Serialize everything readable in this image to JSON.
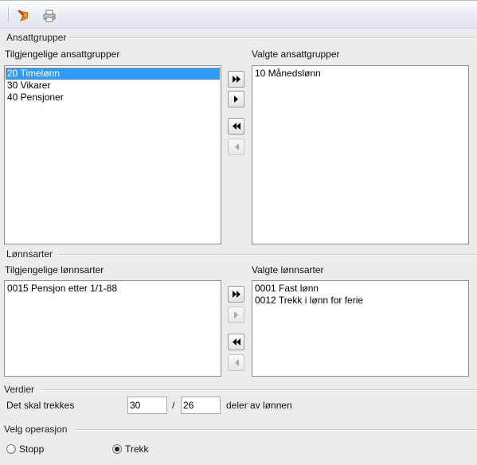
{
  "toolbar": {
    "icons": [
      "clear-icon",
      "print-icon"
    ]
  },
  "ansattgrupper": {
    "section_title": "Ansattgrupper",
    "available_label": "Tilgjengelige ansattgrupper",
    "available_items": [
      "20 Timelønn",
      "30 Vikarer",
      "40 Pensjoner"
    ],
    "selected_index": 0,
    "chosen_label": "Valgte ansattgrupper",
    "chosen_items": [
      "10 Månedslønn"
    ]
  },
  "lonnsarter": {
    "section_title": "Lønnsarter",
    "available_label": "Tilgjengelige lønnsarter",
    "available_items": [
      "0015 Pensjon etter 1/1-88"
    ],
    "chosen_label": "Valgte lønnsarter",
    "chosen_items": [
      "0001 Fast lønn",
      "0012 Trekk i lønn for ferie"
    ]
  },
  "verdier": {
    "section_title": "Verdier",
    "row_label": "Det skal trekkes",
    "numerator": "30",
    "separator": "/",
    "denominator": "26",
    "suffix": "deler av lønnen"
  },
  "operasjon": {
    "section_title": "Velg operasjon",
    "options": [
      "Stopp",
      "Trekk"
    ],
    "selected": "Trekk"
  }
}
